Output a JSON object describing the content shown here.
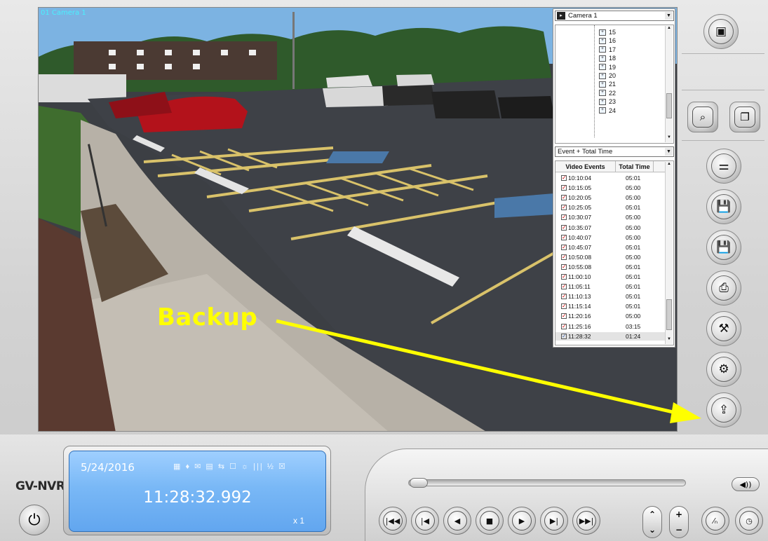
{
  "window": {
    "camera_overlay_label": "01 Camera 1"
  },
  "camera_panel": {
    "camera_select": "Camera 1",
    "tree_items": [
      "15",
      "16",
      "17",
      "18",
      "19",
      "20",
      "21",
      "22",
      "23",
      "24"
    ],
    "event_filter": "Event + Total Time",
    "table_headers": [
      "Video Events",
      "Total Time"
    ],
    "events": [
      {
        "time": "10:10:04",
        "duration": "05:01",
        "checked": true
      },
      {
        "time": "10:15:05",
        "duration": "05:00",
        "checked": true
      },
      {
        "time": "10:20:05",
        "duration": "05:00",
        "checked": true
      },
      {
        "time": "10:25:05",
        "duration": "05:01",
        "checked": true
      },
      {
        "time": "10:30:07",
        "duration": "05:00",
        "checked": true
      },
      {
        "time": "10:35:07",
        "duration": "05:00",
        "checked": true
      },
      {
        "time": "10:40:07",
        "duration": "05:00",
        "checked": true
      },
      {
        "time": "10:45:07",
        "duration": "05:01",
        "checked": true
      },
      {
        "time": "10:50:08",
        "duration": "05:00",
        "checked": true
      },
      {
        "time": "10:55:08",
        "duration": "05:01",
        "checked": true
      },
      {
        "time": "11:00:10",
        "duration": "05:01",
        "checked": true
      },
      {
        "time": "11:05:11",
        "duration": "05:01",
        "checked": true
      },
      {
        "time": "11:10:13",
        "duration": "05:01",
        "checked": true
      },
      {
        "time": "11:15:14",
        "duration": "05:01",
        "checked": true
      },
      {
        "time": "11:20:16",
        "duration": "05:00",
        "checked": true
      },
      {
        "time": "11:25:16",
        "duration": "03:15",
        "checked": true
      },
      {
        "time": "11:28:32",
        "duration": "01:24",
        "checked": false
      }
    ]
  },
  "annotation": {
    "label": "Backup"
  },
  "side_buttons": {
    "top": "camera-layout-icon",
    "zoom": "zoom-search-icon",
    "multi_view": "multi-view-icon",
    "items": [
      "adjust-sliders-icon",
      "save-avi-icon",
      "save-exe-icon",
      "print-icon",
      "tools-icon",
      "settings-icon",
      "backup-icon"
    ]
  },
  "bottom": {
    "brand": "GV-NVR",
    "date": "5/24/2016",
    "time": "11:28:32.992",
    "speed": "x 1",
    "status_icons": "▦ ♦ ✉ ▤ ⇆ ☐ ☼ ||| ½ ☒",
    "transport_glyphs": {
      "first": "|◀◀",
      "prev": "|◀",
      "back": "◀",
      "stop": "■",
      "play": "▶",
      "next": "▶|",
      "last": "▶▶|",
      "audio": "◀))"
    },
    "speed_up": "⌃",
    "speed_down": "⌄",
    "plus": "+",
    "minus": "−"
  },
  "colors": {
    "annotation": "#ffff00",
    "lcd": "#79b8f6",
    "camera_label": "#49f1ff"
  }
}
